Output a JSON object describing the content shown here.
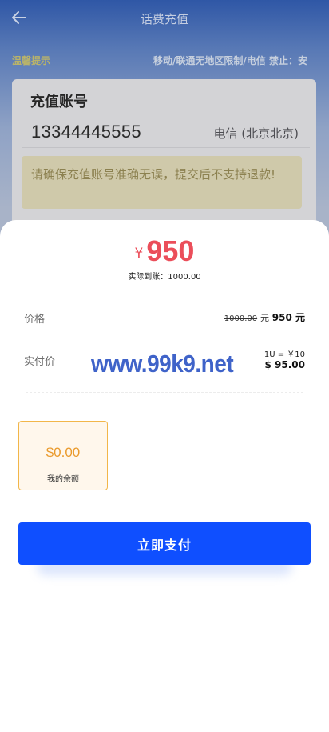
{
  "header": {
    "title": "话费充值",
    "back_icon": "arrow-left-icon"
  },
  "notice": {
    "label": "温馨提示",
    "text": "移动/联通无地区限制/电信 禁止：安"
  },
  "account": {
    "label": "充值账号",
    "number": "13344445555",
    "carrier": "电信 (北京北京)",
    "warning": "请确保充值账号准确无误，提交后不支持退款!"
  },
  "sheet": {
    "currency_symbol": "¥",
    "price": "950",
    "received_label": "实际到账：1000.00",
    "price_label": "价格",
    "original_price": "1000.00",
    "unit": "元",
    "current_price": "950 元",
    "paid_label": "实付价",
    "rate": "1U = ￥10",
    "usd_amount": "$ 95.00",
    "watermark": "www.99k9.net",
    "balance_amount": "$0.00",
    "balance_label": "我的余额",
    "pay_button": "立即支付"
  },
  "colors": {
    "accent": "#0f4fff",
    "price": "#eb4e5a",
    "balance": "#ea9a2c"
  }
}
